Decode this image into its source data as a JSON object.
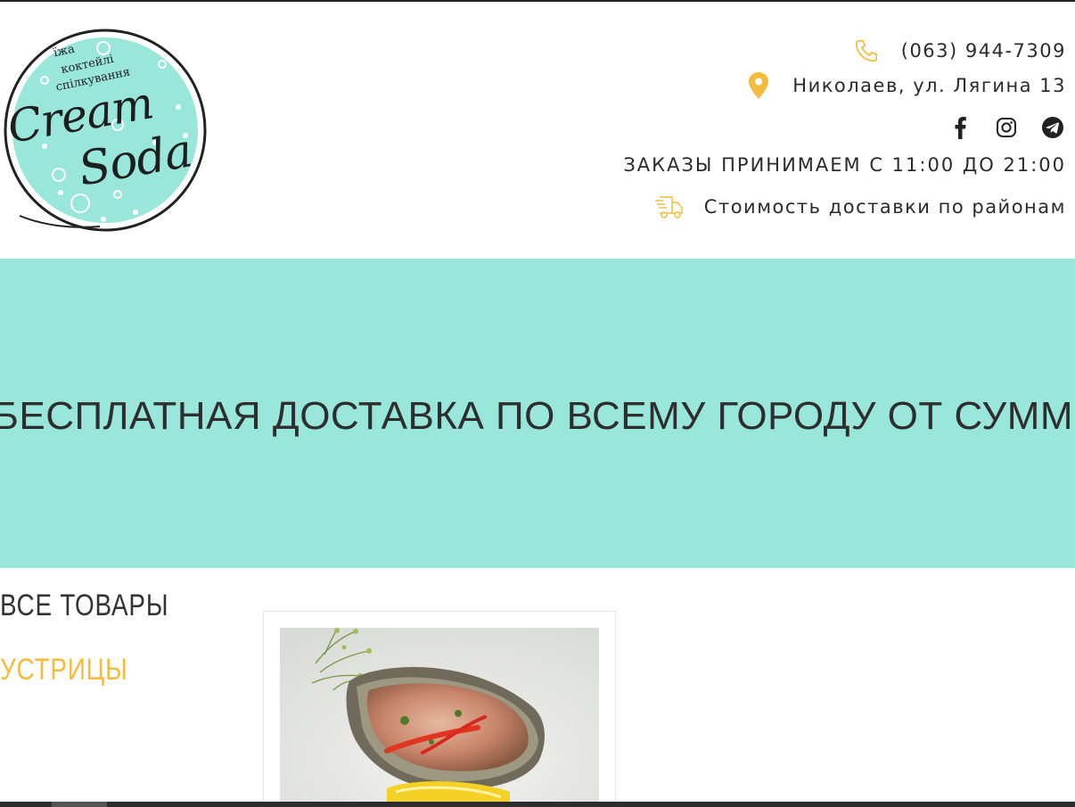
{
  "brand": {
    "tagline_lines": [
      "їжа",
      "коктейлі",
      "спілкування"
    ],
    "logo_words": [
      "Cream",
      "Soda"
    ],
    "logo_color": "#99e6da"
  },
  "contacts": {
    "phone": "(063) 944-7309",
    "address": "Николаев, ул. Лягина 13",
    "hours": "ЗАКАЗЫ ПРИНИМАЕМ С 11:00 ДО 21:00",
    "delivery_link": "Стоимость доставки по районам",
    "icon_color": "#f4bb3e",
    "social_icons": [
      "facebook-icon",
      "instagram-icon",
      "telegram-icon"
    ]
  },
  "banner": {
    "text": "БЕСПЛАТНАЯ ДОСТАВКА ПО ВСЕМУ ГОРОДУ ОТ СУММЫ З",
    "background": "#99e6da"
  },
  "categories": {
    "items": [
      {
        "label": "ВСЕ ТОВАРЫ",
        "active": false
      },
      {
        "label": "УСТРИЦЫ",
        "active": true
      }
    ],
    "active_color": "#f4bb3e"
  }
}
